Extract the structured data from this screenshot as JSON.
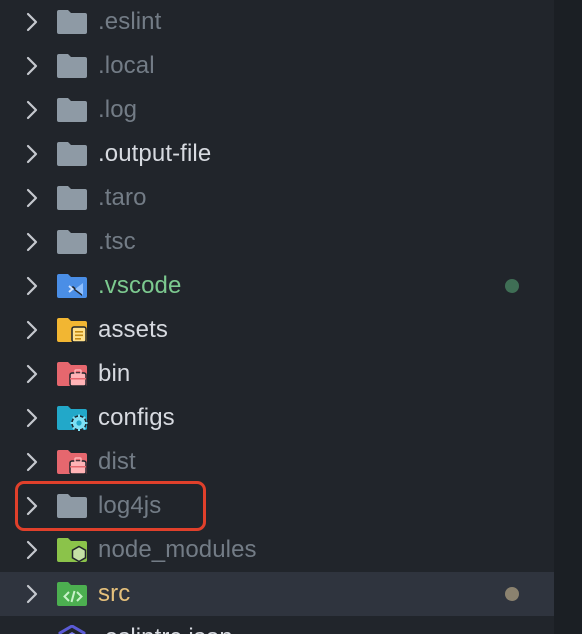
{
  "explorer": {
    "items": [
      {
        "name": ".eslint",
        "icon": "folder-icon",
        "color": "#737c86",
        "git_dot": null
      },
      {
        "name": ".local",
        "icon": "folder-icon",
        "color": "#737c86",
        "git_dot": null
      },
      {
        "name": ".log",
        "icon": "folder-icon",
        "color": "#737c86",
        "git_dot": null
      },
      {
        "name": ".output-file",
        "icon": "folder-icon",
        "color": "#d7dae0",
        "git_dot": null
      },
      {
        "name": ".taro",
        "icon": "folder-icon",
        "color": "#737c86",
        "git_dot": null
      },
      {
        "name": ".tsc",
        "icon": "folder-icon",
        "color": "#737c86",
        "git_dot": null
      },
      {
        "name": ".vscode",
        "icon": "vscode-folder-icon",
        "color": "#7cc98f",
        "git_dot": "#3f6e55"
      },
      {
        "name": "assets",
        "icon": "assets-folder-icon",
        "color": "#d7dae0",
        "git_dot": null
      },
      {
        "name": "bin",
        "icon": "bin-folder-icon",
        "color": "#d7dae0",
        "git_dot": null
      },
      {
        "name": "configs",
        "icon": "config-folder-icon",
        "color": "#d7dae0",
        "git_dot": null
      },
      {
        "name": "dist",
        "icon": "dist-folder-icon",
        "color": "#737c86",
        "git_dot": null
      },
      {
        "name": "log4js",
        "icon": "folder-icon",
        "color": "#737c86",
        "git_dot": null
      },
      {
        "name": "node_modules",
        "icon": "node-folder-icon",
        "color": "#737c86",
        "git_dot": null
      },
      {
        "name": "src",
        "icon": "src-folder-icon",
        "color": "#e5c07b",
        "git_dot": "#8b826f"
      },
      {
        "name": ".eslintrc.json",
        "icon": "eslint-file-icon",
        "color": "#d7dae0",
        "git_dot": null
      }
    ],
    "selected_item": "src",
    "highlighted_item": "log4js"
  },
  "colors": {
    "background": "#21252b",
    "selected_row": "#2f343e",
    "highlight_border": "#e0402b"
  }
}
